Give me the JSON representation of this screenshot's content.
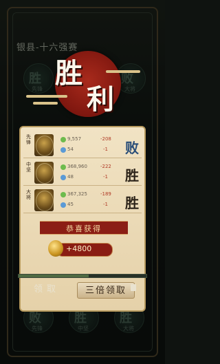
{
  "background": {
    "title": "银县-十六强赛",
    "left_badge": "胜",
    "left_badge_sub": "先锋",
    "right_badge": "败",
    "right_badge_sub": "大将",
    "bottom_left_badge": "败",
    "bottom_left_sub": "先锋",
    "bottom_mid_badge": "胜",
    "bottom_mid_sub": "中坚",
    "bottom_right_badge": "胜",
    "bottom_right_sub": "大将"
  },
  "emblem": {
    "char1": "胜",
    "char2": "利"
  },
  "rows": [
    {
      "position": "先锋",
      "stat1": "9,557",
      "delta1": "-208",
      "stat2": "54",
      "delta2": "-1",
      "result": "败",
      "result_kind": "lose"
    },
    {
      "position": "中坚",
      "stat1": "368,960",
      "delta1": "-222",
      "stat2": "48",
      "delta2": "-1",
      "result": "胜",
      "result_kind": "win"
    },
    {
      "position": "大将",
      "stat1": "367,325",
      "delta1": "-189",
      "stat2": "45",
      "delta2": "-1",
      "result": "胜",
      "result_kind": "win"
    }
  ],
  "reward": {
    "banner": "恭喜获得",
    "amount": "+4800"
  },
  "progress_fraction": 0.55,
  "buttons": {
    "claim": "领取",
    "triple_claim": "三倍领取"
  }
}
